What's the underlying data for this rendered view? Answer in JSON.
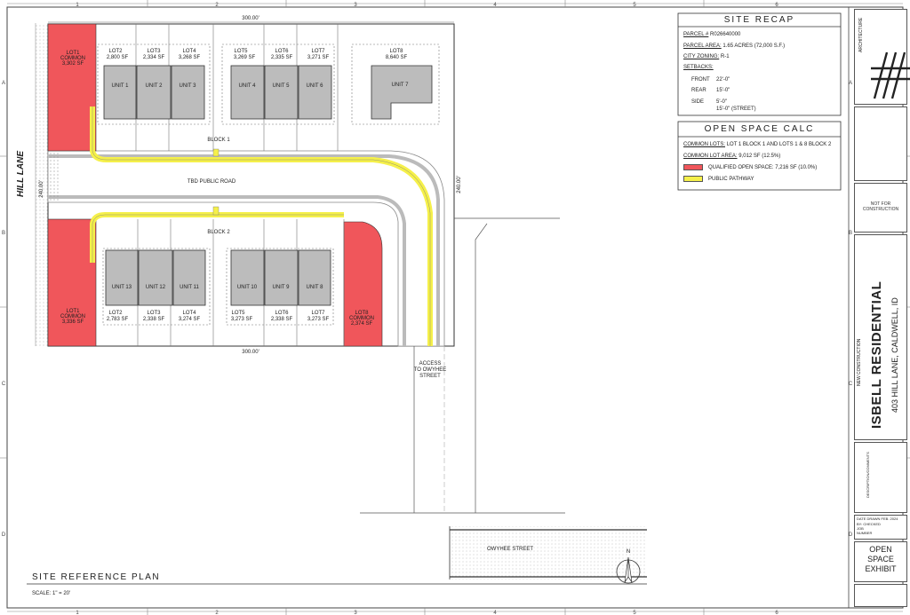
{
  "grid": {
    "columns": [
      "1",
      "2",
      "3",
      "4",
      "5",
      "6"
    ],
    "rows": [
      "A",
      "B",
      "C",
      "D"
    ]
  },
  "plan": {
    "street_name": "HILL LANE",
    "road_label": "TBD PUBLIC ROAD",
    "block_1": "BLOCK 1",
    "block_2": "BLOCK 2",
    "dim_top": "300.00'",
    "dim_bottom": "300.00'",
    "dim_left": "240.00'",
    "dim_right": "240.00'",
    "access_label": [
      "ACCESS",
      "TO OWYHEE",
      "STREET"
    ],
    "owyhee_street": "OWYHEE STREET",
    "title": "SITE REFERENCE PLAN",
    "scale": "SCALE: 1\" = 20'",
    "north": "N"
  },
  "lots_top": [
    {
      "lot": "LOT1",
      "extra": "COMMON",
      "sf": "3,302 SF"
    },
    {
      "lot": "LOT2",
      "sf": "2,800 SF"
    },
    {
      "lot": "LOT3",
      "sf": "2,334 SF"
    },
    {
      "lot": "LOT4",
      "sf": "3,268 SF"
    },
    {
      "lot": "LOT5",
      "sf": "3,269 SF"
    },
    {
      "lot": "LOT6",
      "sf": "2,335 SF"
    },
    {
      "lot": "LOT7",
      "sf": "3,271 SF"
    },
    {
      "lot": "LOT8",
      "sf": "8,640 SF"
    }
  ],
  "lots_bottom": [
    {
      "lot": "LOT1",
      "extra": "COMMON",
      "sf": "3,336 SF"
    },
    {
      "lot": "LOT2",
      "sf": "2,783 SF"
    },
    {
      "lot": "LOT3",
      "sf": "2,338 SF"
    },
    {
      "lot": "LOT4",
      "sf": "3,274 SF"
    },
    {
      "lot": "LOT5",
      "sf": "3,273 SF"
    },
    {
      "lot": "LOT6",
      "sf": "2,338 SF"
    },
    {
      "lot": "LOT7",
      "sf": "3,273 SF"
    },
    {
      "lot": "LOT8",
      "extra": "COMMON",
      "sf": "2,374 SF"
    }
  ],
  "units_top": [
    "UNIT 1",
    "UNIT 2",
    "UNIT 3",
    "UNIT 4",
    "UNIT 5",
    "UNIT 6",
    "UNIT 7"
  ],
  "units_bottom": [
    "UNIT 13",
    "UNIT 12",
    "UNIT 11",
    "UNIT 10",
    "UNIT 9",
    "UNIT 8"
  ],
  "site_recap": {
    "title": "SITE RECAP",
    "parcel_label": "PARCEL #",
    "parcel_value": "R026640000",
    "area_label": "PARCEL AREA:",
    "area_value": "1.65 ACRES (72,000 S.F.)",
    "zoning_label": "CITY ZONING:",
    "zoning_value": "R-1",
    "setbacks_label": "SETBACKS:",
    "front_label": "FRONT",
    "front_value": "22'-0\"",
    "rear_label": "REAR",
    "rear_value": "15'-0\"",
    "side_label": "SIDE",
    "side_value_1": "5'-0\"",
    "side_value_2": "15'-0\" (STREET)"
  },
  "open_space": {
    "title": "OPEN SPACE CALC",
    "common_lots_label": "COMMON LOTS:",
    "common_lots_value": "LOT 1 BLOCK 1 AND LOTS 1 & 8 BLOCK 2",
    "common_area_label": "COMMON LOT AREA:",
    "common_area_value": "9,012 SF (12.5%)",
    "legend_qualified": "QUALIFIED OPEN SPACE: 7,216 SF (10.0%)",
    "legend_pathway": "PUBLIC PATHWAY"
  },
  "title_block": {
    "firm": "ARCHITECTURE",
    "not_for_construction": [
      "NOT FOR",
      "CONSTRUCTION"
    ],
    "new_construction": "NEW CONSTRUCTION",
    "project": "ISBELL RESIDENTIAL",
    "address": "403 HILL LANE, CALDWELL, ID",
    "revisions_header": "DESCRIPTION/COMMENTS",
    "date_row": "DATE DRAWN    FEB. 2024",
    "checked_row": "BY: CHECKED",
    "job_row": "JOB",
    "number_row": "NUMBER",
    "sheet_title": [
      "OPEN",
      "SPACE",
      "EXHIBIT"
    ]
  },
  "colors": {
    "open_space": "#f0565b",
    "pathway": "#f5f04a",
    "building": "#bcbcbc",
    "road_edge": "#d9d9d9"
  }
}
